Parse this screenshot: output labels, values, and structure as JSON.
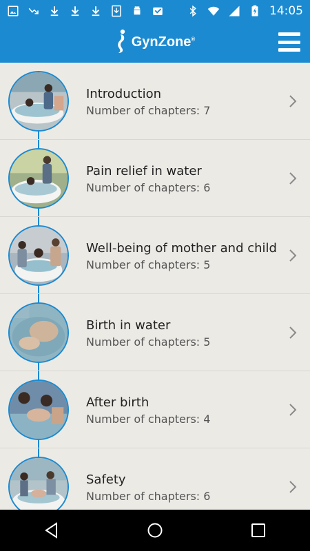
{
  "status_bar": {
    "time": "14:05",
    "left_icons": [
      "image-icon",
      "missed-call-icon",
      "download-icon",
      "download-icon",
      "download-icon",
      "download-box-icon",
      "android-icon",
      "inbox-icon"
    ],
    "right_icons": [
      "bluetooth-icon",
      "wifi-icon",
      "signal-icon",
      "battery-charging-icon"
    ]
  },
  "app_bar": {
    "logo_text": "GynZone",
    "logo_reg": "®",
    "menu_icon": "hamburger-menu-icon",
    "color": "#1b8ad0"
  },
  "items": [
    {
      "title": "Introduction",
      "subtitle": "Number of chapters: 7"
    },
    {
      "title": "Pain relief in water",
      "subtitle": "Number of chapters: 6"
    },
    {
      "title": "Well-being of mother and child",
      "subtitle": "Number of chapters: 5"
    },
    {
      "title": "Birth in water",
      "subtitle": "Number of chapters: 5"
    },
    {
      "title": "After birth",
      "subtitle": "Number of chapters: 4"
    },
    {
      "title": "Safety",
      "subtitle": "Number of chapters: 6"
    }
  ],
  "nav_bar": {
    "icons": [
      "back-icon",
      "home-icon",
      "recents-icon"
    ]
  }
}
